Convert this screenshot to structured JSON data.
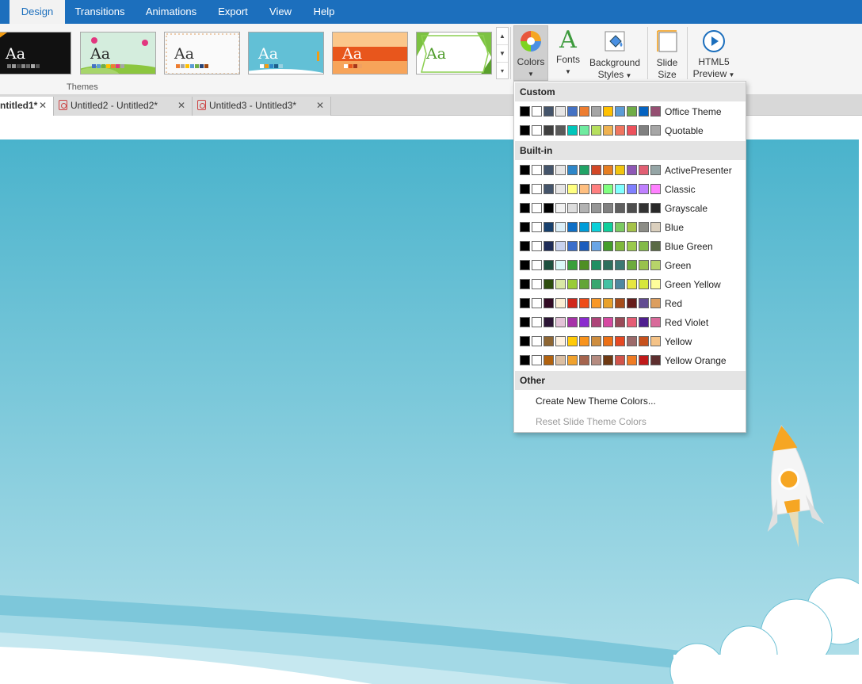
{
  "menu": {
    "tabs": [
      {
        "label": "Design",
        "active": true
      },
      {
        "label": "Transitions"
      },
      {
        "label": "Animations"
      },
      {
        "label": "Export"
      },
      {
        "label": "View"
      },
      {
        "label": "Help"
      }
    ]
  },
  "ribbon": {
    "themes_group_label": "Themes",
    "theme_thumbs": [
      {
        "text": "Aa"
      },
      {
        "text": "Aa"
      },
      {
        "text": "Aa"
      },
      {
        "text": "Aa"
      },
      {
        "text": "Aa"
      },
      {
        "text": "Aa"
      }
    ],
    "buttons": {
      "colors": "Colors",
      "fonts": "Fonts",
      "background_line1": "Background",
      "background_line2": "Styles",
      "slide_line1": "Slide",
      "slide_line2": "Size",
      "html5_line1": "HTML5",
      "html5_line2": "Preview"
    },
    "icons": {
      "colors": "palette-icon",
      "fonts": "font-a-icon",
      "background": "paint-bucket-icon",
      "slide_size": "slide-size-icon",
      "html5": "play-circle-icon"
    },
    "accent_color": "#1c6fbd"
  },
  "doc_tabs": [
    {
      "label": "ntitled1*",
      "active": true
    },
    {
      "label": "Untitled2 - Untitled2*"
    },
    {
      "label": "Untitled3 - Untitled3*"
    }
  ],
  "colors_dropdown": {
    "sections": {
      "custom": "Custom",
      "builtin": "Built-in",
      "other": "Other"
    },
    "custom_rows": [
      {
        "name": "Office Theme",
        "colors": [
          "#000000",
          "#ffffff",
          "#44546a",
          "#e7e6e6",
          "#4472c4",
          "#ed7d31",
          "#a5a5a5",
          "#ffc000",
          "#5b9bd5",
          "#70ad47",
          "#0563c1",
          "#954f72"
        ]
      },
      {
        "name": "Quotable",
        "colors": [
          "#000000",
          "#ffffff",
          "#3f3f3f",
          "#5a5a5a",
          "#00c6bb",
          "#6feba0",
          "#b6df5e",
          "#efb251",
          "#ef755f",
          "#ed515c",
          "#808080",
          "#a6a6a6"
        ]
      }
    ],
    "builtin_rows": [
      {
        "name": "ActivePresenter",
        "colors": [
          "#000000",
          "#ffffff",
          "#44546a",
          "#e7e6e6",
          "#2e86c8",
          "#21a366",
          "#d24726",
          "#e67e22",
          "#f1c40f",
          "#8e58b6",
          "#e15f73",
          "#95a5a6"
        ]
      },
      {
        "name": "Classic",
        "colors": [
          "#000000",
          "#ffffff",
          "#44546a",
          "#e7e6e6",
          "#ffff80",
          "#ffbf80",
          "#ff8080",
          "#80ff80",
          "#80ffff",
          "#8080ff",
          "#bf80ff",
          "#ff80ff"
        ]
      },
      {
        "name": "Grayscale",
        "colors": [
          "#000000",
          "#ffffff",
          "#000000",
          "#f2f2f2",
          "#dddddd",
          "#b2b2b2",
          "#969696",
          "#808080",
          "#5f5f5f",
          "#4d4d4d",
          "#333333",
          "#292929"
        ]
      },
      {
        "name": "Blue",
        "colors": [
          "#000000",
          "#ffffff",
          "#17406d",
          "#dbeff9",
          "#0f6fc6",
          "#009dd9",
          "#0bd0d9",
          "#10cf9b",
          "#7cca62",
          "#a5c249",
          "#8c8d86",
          "#dacfbd"
        ]
      },
      {
        "name": "Blue Green",
        "colors": [
          "#000000",
          "#ffffff",
          "#1f2d58",
          "#c9d3ef",
          "#3a6ecb",
          "#1b5dbd",
          "#6aa6e6",
          "#449d2a",
          "#7fb83c",
          "#9ac94c",
          "#83ba49",
          "#5a6a45"
        ]
      },
      {
        "name": "Green",
        "colors": [
          "#000000",
          "#ffffff",
          "#1e4f3e",
          "#dbf9f9",
          "#3a9f3b",
          "#4e8f24",
          "#1f8f63",
          "#2f6f5d",
          "#3c7873",
          "#6dab3d",
          "#99c24c",
          "#b7d469"
        ]
      },
      {
        "name": "Green Yellow",
        "colors": [
          "#000000",
          "#ffffff",
          "#2d4d0e",
          "#d9e8a6",
          "#99cb38",
          "#63a537",
          "#37a76f",
          "#44c1a3",
          "#4e88a0",
          "#e6e640",
          "#d6e73c",
          "#fffd9b"
        ]
      },
      {
        "name": "Red",
        "colors": [
          "#000000",
          "#ffffff",
          "#320b24",
          "#fbeed4",
          "#d0281b",
          "#ef4c18",
          "#f89828",
          "#e8a129",
          "#a64d1b",
          "#661e1b",
          "#614b91",
          "#dc9e5f"
        ]
      },
      {
        "name": "Red Violet",
        "colors": [
          "#000000",
          "#ffffff",
          "#2c1535",
          "#e3c3d8",
          "#a633a8",
          "#8b2bcf",
          "#ae4479",
          "#d649a1",
          "#9a4a58",
          "#e55d75",
          "#4f1e8f",
          "#d96a9a"
        ]
      },
      {
        "name": "Yellow",
        "colors": [
          "#000000",
          "#ffffff",
          "#8e6633",
          "#fff2e0",
          "#ffca08",
          "#f8931d",
          "#ce8d3e",
          "#ec7016",
          "#e64823",
          "#9c6a6a",
          "#c7511d",
          "#f5c387"
        ]
      },
      {
        "name": "Yellow Orange",
        "colors": [
          "#000000",
          "#ffffff",
          "#b1620f",
          "#dbbfa3",
          "#f0a22e",
          "#a5644e",
          "#b58b80",
          "#6f3a13",
          "#d1544b",
          "#ef7b24",
          "#c01a1a",
          "#5e2f2f"
        ]
      }
    ],
    "other_items": [
      {
        "label": "Create New Theme Colors...",
        "enabled": true
      },
      {
        "label": "Reset Slide Theme Colors",
        "enabled": false
      }
    ]
  },
  "slide": {
    "sky_top": "#4ab3cc",
    "sky_bottom": "#b3e0ea"
  }
}
